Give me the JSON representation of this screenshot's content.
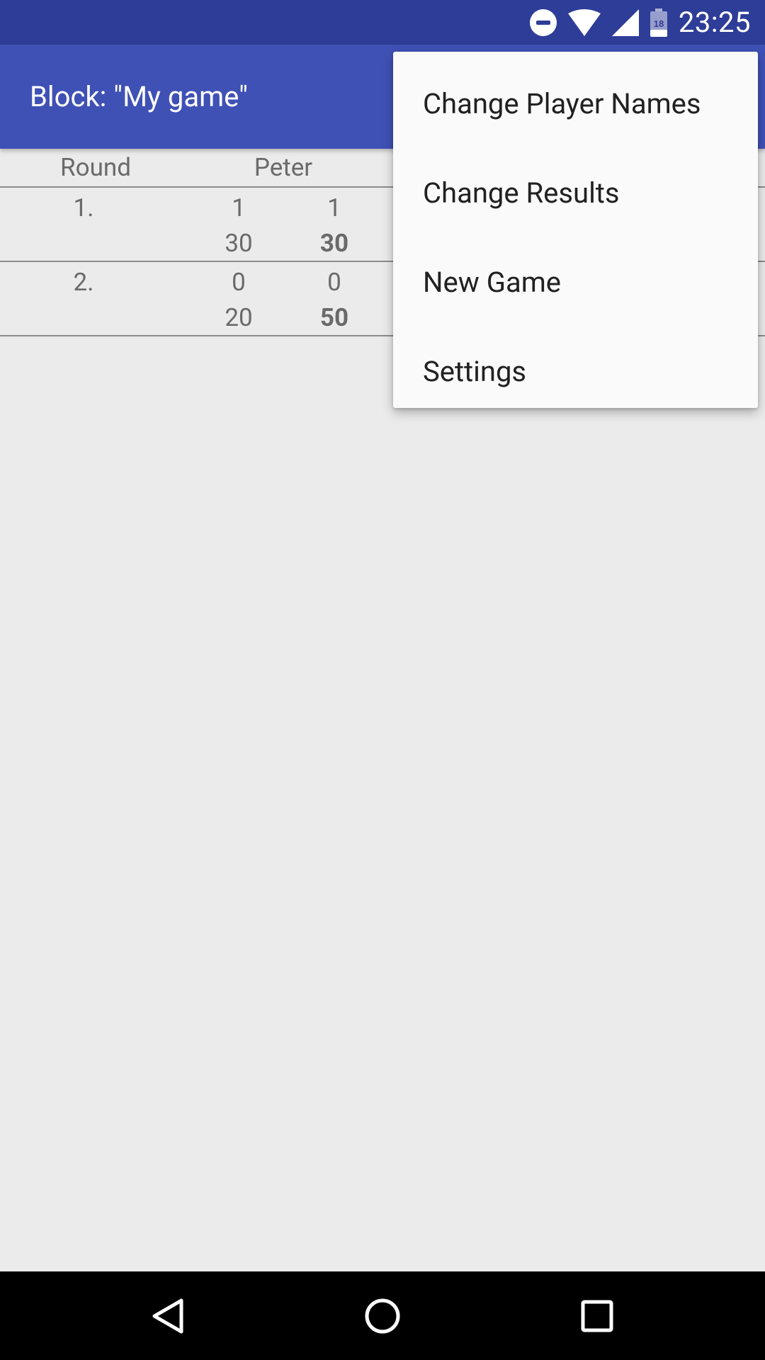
{
  "status_bar": {
    "time": "23:25",
    "battery_level": "18",
    "icons": [
      "do-not-disturb-icon",
      "wifi-icon",
      "cell-signal-icon",
      "battery-icon"
    ]
  },
  "app_bar": {
    "title": "Block: \"My game\""
  },
  "table": {
    "headers": [
      "Round",
      "Peter"
    ],
    "rounds": [
      {
        "label": "1.",
        "player_value": "1",
        "cumulative_value": "1",
        "player_points": "30",
        "total_points": "30"
      },
      {
        "label": "2.",
        "player_value": "0",
        "cumulative_value": "0",
        "player_points": "20",
        "total_points": "50"
      }
    ]
  },
  "menu": {
    "items": [
      "Change Player Names",
      "Change Results",
      "New Game",
      "Settings"
    ]
  },
  "nav_bar": {
    "buttons": [
      "back-icon",
      "home-icon",
      "recents-icon"
    ]
  },
  "colors": {
    "status_bar": "#2e3d98",
    "app_bar": "#3f51b5",
    "background": "#ebebeb",
    "menu_background": "#fafafa",
    "nav_bar": "#000000"
  }
}
